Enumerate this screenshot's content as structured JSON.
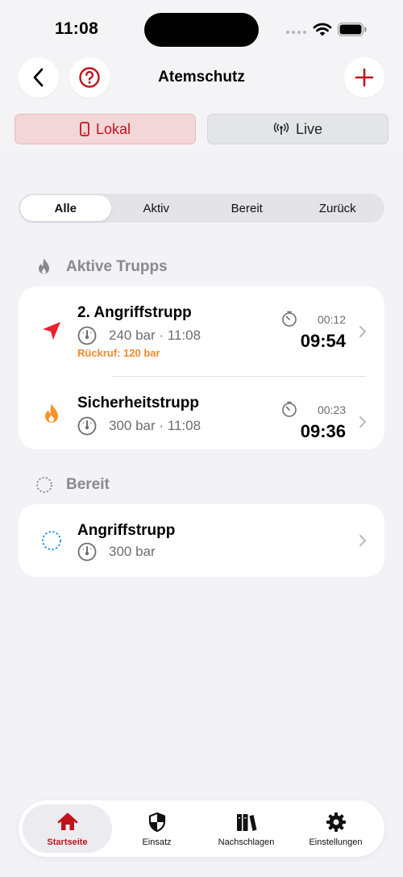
{
  "status": {
    "time": "11:08"
  },
  "nav": {
    "title": "Atemschutz",
    "back_icon": "chevron-left-icon",
    "help_icon": "question-circle-icon",
    "add_icon": "plus-icon"
  },
  "modes": [
    {
      "label": "Lokal",
      "icon": "phone-icon",
      "selected": true
    },
    {
      "label": "Live",
      "icon": "antenna-icon",
      "selected": false
    }
  ],
  "filters": [
    {
      "label": "Alle",
      "selected": true
    },
    {
      "label": "Aktiv",
      "selected": false
    },
    {
      "label": "Bereit",
      "selected": false
    },
    {
      "label": "Zurück",
      "selected": false
    }
  ],
  "sections": {
    "active": {
      "title": "Aktive Trupps",
      "icon": "flame-icon",
      "items": [
        {
          "name": "2. Angriffstrupp",
          "meta": "240 bar · 11:08",
          "alert": "Rückruf: 120 bar",
          "timer_small": "00:12",
          "timer_big": "09:54",
          "icon": "location-arrow-icon"
        },
        {
          "name": "Sicherheitstrupp",
          "meta": "300 bar · 11:08",
          "timer_small": "00:23",
          "timer_big": "09:36",
          "icon": "flame-icon"
        }
      ]
    },
    "ready": {
      "title": "Bereit",
      "icon": "dashed-circle-icon",
      "items": [
        {
          "name": "Angriffstrupp",
          "meta": "300 bar",
          "icon": "dashed-circle-icon"
        }
      ]
    }
  },
  "tabbar": [
    {
      "label": "Startseite",
      "icon": "house-icon",
      "selected": true
    },
    {
      "label": "Einsatz",
      "icon": "shield-icon",
      "selected": false
    },
    {
      "label": "Nachschlagen",
      "icon": "books-icon",
      "selected": false
    },
    {
      "label": "Einstellungen",
      "icon": "gear-icon",
      "selected": false
    }
  ],
  "colors": {
    "accent": "#c0141c",
    "orange": "#f08a2a",
    "blue": "#1e8be0",
    "background": "#f2f2f7"
  }
}
